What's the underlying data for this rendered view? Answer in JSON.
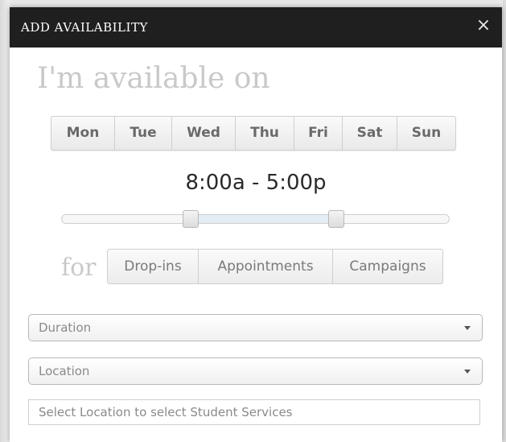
{
  "dialog": {
    "title": "ADD AVAILABILITY",
    "close_glyph": "×",
    "headline": "I'm available on"
  },
  "days": [
    "Mon",
    "Tue",
    "Wed",
    "Thu",
    "Fri",
    "Sat",
    "Sun"
  ],
  "time": {
    "range_label": "8:00a - 5:00p",
    "start_fraction": 0.333,
    "end_fraction": 0.708
  },
  "appointment_types": {
    "prefix": "for",
    "options": [
      "Drop-ins",
      "Appointments",
      "Campaigns"
    ]
  },
  "duration_select": {
    "label": "Duration"
  },
  "location_select": {
    "label": "Location"
  },
  "services_input": {
    "placeholder": "Select Location to select Student Services",
    "value": ""
  },
  "colors": {
    "header_bg": "#1f1f1f",
    "header_text": "#ffffff",
    "muted_heading": "#c9c9c9"
  },
  "icons": {
    "close": "close-icon",
    "caret": "chevron-down-icon"
  }
}
